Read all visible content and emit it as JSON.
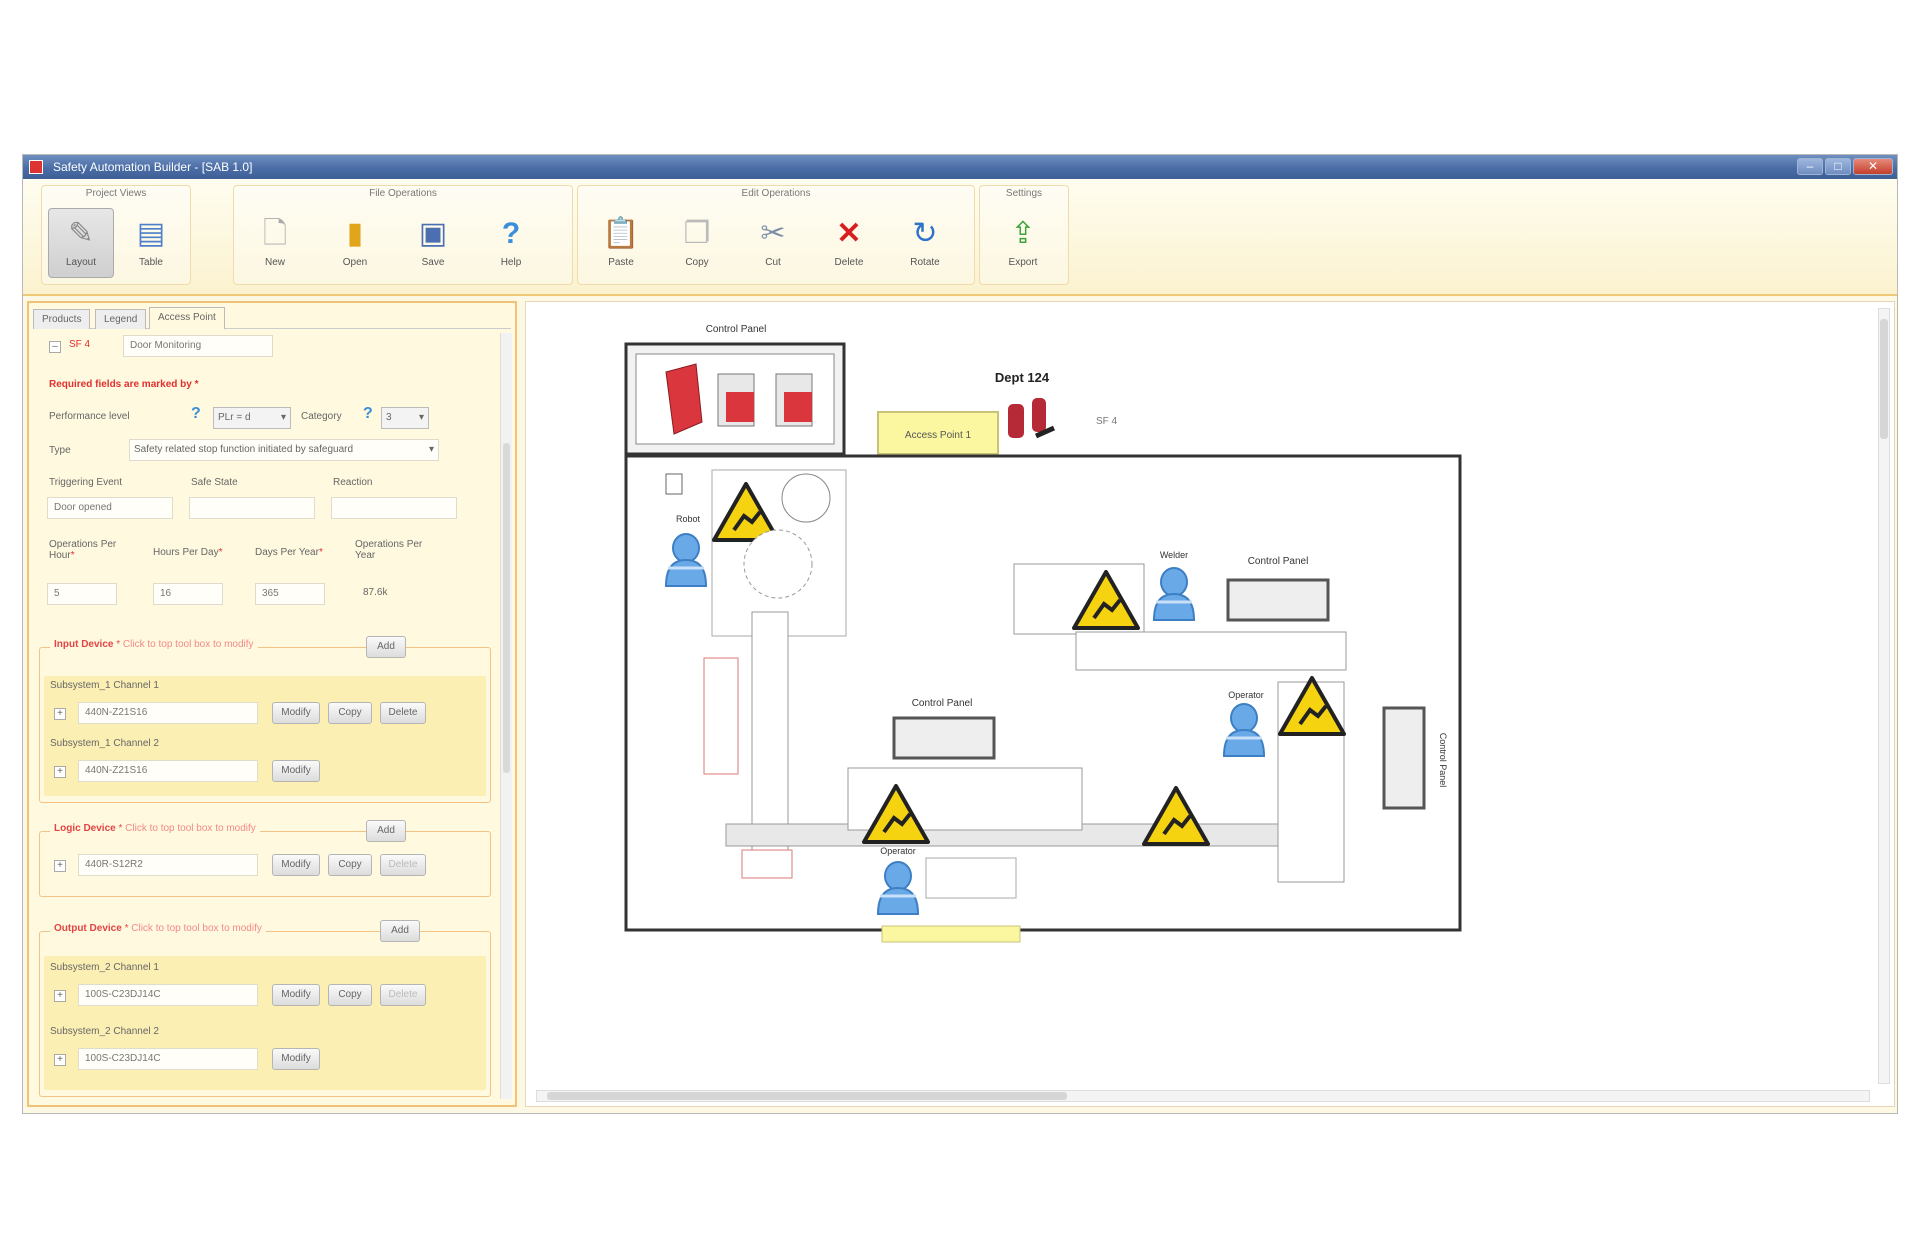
{
  "window": {
    "title": "Safety Automation Builder - [SAB 1.0]",
    "min": "–",
    "max": "□",
    "close": "✕"
  },
  "ribbon": {
    "groups": [
      {
        "title": "Project Views",
        "buttons": [
          "Layout",
          "Table"
        ]
      },
      {
        "title": "File Operations",
        "buttons": [
          "New",
          "Open",
          "Save",
          "Help"
        ]
      },
      {
        "title": "Edit Operations",
        "buttons": [
          "Paste",
          "Copy",
          "Cut",
          "Delete",
          "Rotate"
        ]
      },
      {
        "title": "Settings",
        "buttons": [
          "Export"
        ]
      }
    ]
  },
  "left": {
    "tabs": [
      "Products",
      "Legend",
      "Access Point"
    ],
    "header": {
      "id": "SF 4",
      "name": "Door Monitoring"
    },
    "required_note": "Required fields are marked by *",
    "perf_level": {
      "label": "Performance level",
      "value": "PLr = d"
    },
    "category": {
      "label": "Category",
      "value": "3"
    },
    "type": {
      "label": "Type",
      "value": "Safety related stop function initiated by safeguard"
    },
    "triggering": {
      "label": "Triggering Event",
      "value": "Door opened"
    },
    "safe_state": {
      "label": "Safe State",
      "value": ""
    },
    "reaction": {
      "label": "Reaction",
      "value": ""
    },
    "ops_per_hour": {
      "label": "Operations Per Hour",
      "value": "5"
    },
    "hours_per_day": {
      "label": "Hours Per Day",
      "value": "16"
    },
    "days_per_year": {
      "label": "Days Per Year",
      "value": "365"
    },
    "ops_per_year": {
      "label": "Operations Per Year",
      "value": "87.6k"
    },
    "input": {
      "title": "Input Device",
      "hint": "Click to top tool box to modify",
      "add": "Add",
      "rows": [
        {
          "label": "Subsystem_1 Channel 1",
          "value": "440N-Z21S16",
          "buttons": [
            "Modify",
            "Copy",
            "Delete"
          ]
        },
        {
          "label": "Subsystem_1 Channel 2",
          "value": "440N-Z21S16",
          "buttons": [
            "Modify"
          ]
        }
      ]
    },
    "logic": {
      "title": "Logic Device",
      "hint": "Click to top tool box to modify",
      "add": "Add",
      "rows": [
        {
          "label": "",
          "value": "440R-S12R2",
          "buttons": [
            "Modify",
            "Copy",
            "Delete"
          ]
        }
      ]
    },
    "output": {
      "title": "Output Device",
      "hint": "Click to top tool box to modify",
      "add": "Add",
      "rows": [
        {
          "label": "Subsystem_2 Channel 1",
          "value": "100S-C23DJ14C",
          "buttons": [
            "Modify",
            "Copy",
            "Delete"
          ]
        },
        {
          "label": "Subsystem_2 Channel 2",
          "value": "100S-C23DJ14C",
          "buttons": [
            "Modify"
          ]
        }
      ]
    }
  },
  "canvas": {
    "control_panel_top": "Control Panel",
    "dept": "Dept 124",
    "access_point": "Access Point 1",
    "sf_tag": "SF 4",
    "labels": {
      "robot": "Robot",
      "welder": "Welder",
      "operator": "Operator",
      "operator2": "Operator",
      "cp1": "Control Panel",
      "cp2": "Control Panel",
      "cp3": "Control Panel"
    },
    "colors": {
      "warning": "#f6d311",
      "person": "#6aa9e8",
      "relay": "#d9363e",
      "access": "#fbf7a0"
    }
  }
}
